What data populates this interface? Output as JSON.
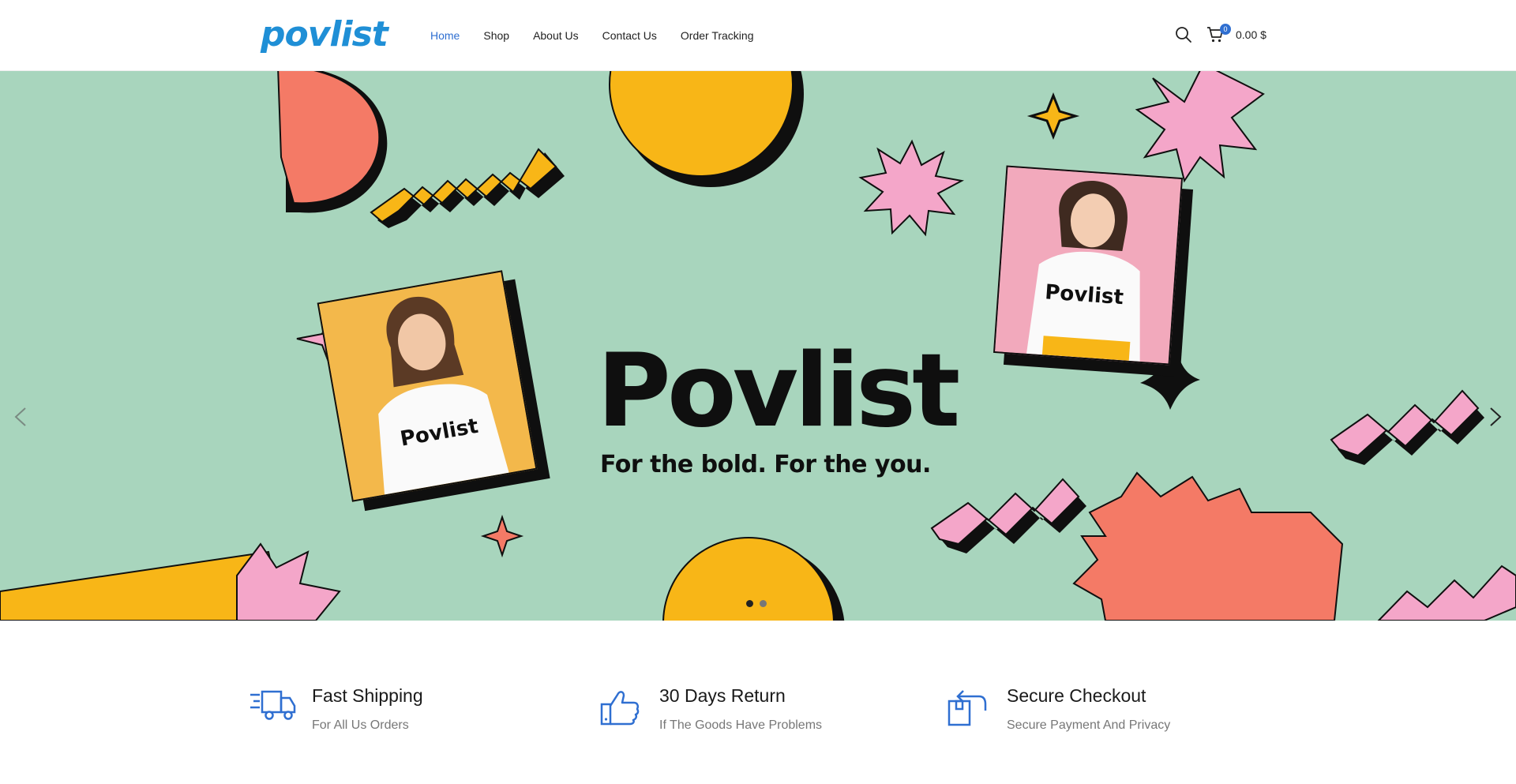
{
  "header": {
    "logo_text": "povlist",
    "nav": [
      {
        "label": "Home",
        "active": true
      },
      {
        "label": "Shop",
        "active": false
      },
      {
        "label": "About Us",
        "active": false
      },
      {
        "label": "Contact Us",
        "active": false
      },
      {
        "label": "Order Tracking",
        "active": false
      }
    ],
    "search_icon": "search-icon",
    "cart_icon": "cart-icon",
    "cart_count": "0",
    "cart_total": "0.00 $"
  },
  "hero": {
    "title": "Povlist",
    "subtitle": "For the bold. For the you.",
    "shirt_text_left": "Povlist",
    "shirt_text_right": "Povlist",
    "prev_icon": "chevron-left-icon",
    "next_icon": "chevron-right-icon",
    "slide_count": 2,
    "active_slide": 1
  },
  "features": [
    {
      "icon": "delivery-truck-icon",
      "title": "Fast Shipping",
      "subtitle": "For All Us Orders"
    },
    {
      "icon": "thumbs-up-icon",
      "title": "30 Days Return",
      "subtitle": "If The Goods Have Problems"
    },
    {
      "icon": "return-box-icon",
      "title": "Secure Checkout",
      "subtitle": "Secure Payment And Privacy"
    }
  ],
  "colors": {
    "accent": "#2f6fd1",
    "logo": "#1f8fd6",
    "hero_bg": "#a8d5bd",
    "yellow": "#f8b617",
    "pink": "#f4a6c9",
    "coral": "#f47a66"
  }
}
